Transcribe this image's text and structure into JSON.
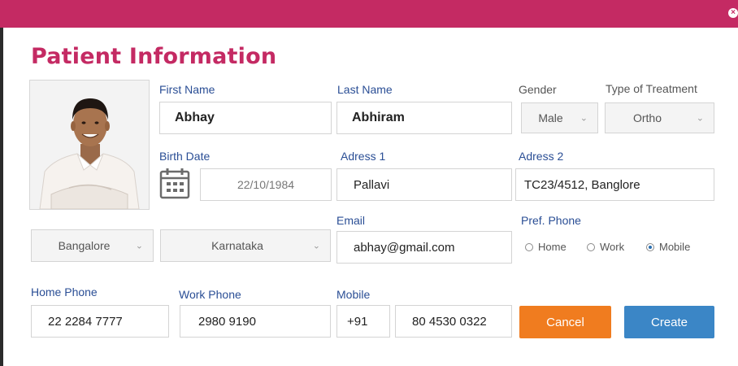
{
  "colors": {
    "accent": "#c42a63",
    "label": "#2a4e95",
    "cancel": "#f07c1f",
    "create": "#3b86c6"
  },
  "title": "Patient Information",
  "photo": {
    "icon": "patient-photo"
  },
  "labels": {
    "first_name": "First Name",
    "last_name": "Last Name",
    "gender": "Gender",
    "type_of_treatment": "Type of Treatment",
    "birth_date": "Birth Date",
    "address1": "Adress 1",
    "address2": "Adress 2",
    "email": "Email",
    "pref_phone": "Pref. Phone",
    "home_phone": "Home Phone",
    "work_phone": "Work Phone",
    "mobile": "Mobile"
  },
  "values": {
    "first_name": "Abhay",
    "last_name": "Abhiram",
    "gender": "Male",
    "type_of_treatment": "Ortho",
    "birth_date": "22/10/1984",
    "address1": "Pallavi",
    "address2": "TC23/4512, Banglore",
    "city": "Bangalore",
    "state": "Karnataka",
    "email": "abhay@gmail.com",
    "home_phone": "22 2284 7777",
    "work_phone": "2980 9190",
    "mobile_code": "+91",
    "mobile_number": "80 4530 0322"
  },
  "pref_phone_options": [
    "Home",
    "Work",
    "Mobile"
  ],
  "pref_phone_selected": "Mobile",
  "buttons": {
    "cancel": "Cancel",
    "create": "Create"
  }
}
